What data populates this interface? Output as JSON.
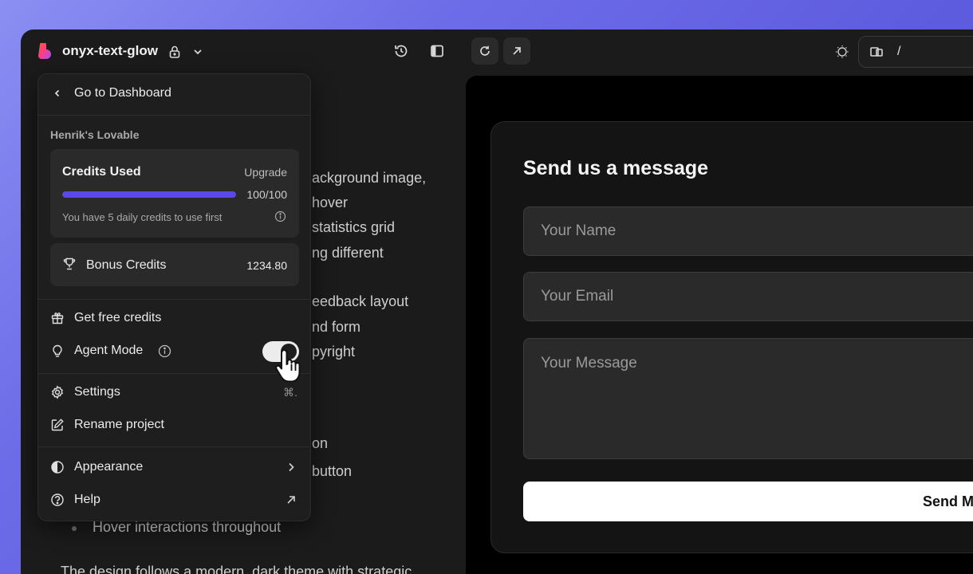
{
  "header": {
    "project_name": "onyx-text-glow",
    "url_path": "/"
  },
  "chat": {
    "lines": [
      "ackground image,",
      "hover",
      "statistics grid",
      "ng different",
      "eedback layout",
      "nd form",
      "pyright",
      "on",
      "button",
      "Hover interactions throughout",
      "The design follows a modern, dark theme with strategic"
    ]
  },
  "menu": {
    "go_to_dashboard": "Go to Dashboard",
    "workspace_label": "Henrik's Lovable",
    "credits": {
      "title": "Credits Used",
      "upgrade_label": "Upgrade",
      "used": 100,
      "total": 100,
      "progress_text": "100/100",
      "note": "You have 5 daily credits to use first"
    },
    "bonus": {
      "label": "Bonus Credits",
      "value": "1234.80"
    },
    "get_free_credits": "Get free credits",
    "agent_mode": "Agent Mode",
    "agent_mode_on": true,
    "settings": "Settings",
    "settings_shortcut": "⌘.",
    "rename_project": "Rename project",
    "appearance": "Appearance",
    "help": "Help"
  },
  "preview": {
    "form_title": "Send us a message",
    "name_placeholder": "Your Name",
    "email_placeholder": "Your Email",
    "message_placeholder": "Your Message",
    "send_label": "Send M"
  },
  "colors": {
    "accent_progress": "#5a48e8",
    "background_gradient": "#6d6ce8",
    "window_bg": "#1b1b1b"
  },
  "icons": [
    "logo-icon",
    "lock-icon",
    "chevron-down-icon",
    "history-icon",
    "sidebar-toggle-icon",
    "refresh-icon",
    "open-external-icon",
    "sun-icon",
    "devices-icon",
    "chevron-left-icon",
    "info-icon",
    "trophy-icon",
    "gift-icon",
    "lightbulb-icon",
    "gear-icon",
    "edit-icon",
    "contrast-icon",
    "chevron-right-icon",
    "help-circle-icon",
    "arrow-up-right-icon",
    "pointer-hand-icon"
  ]
}
